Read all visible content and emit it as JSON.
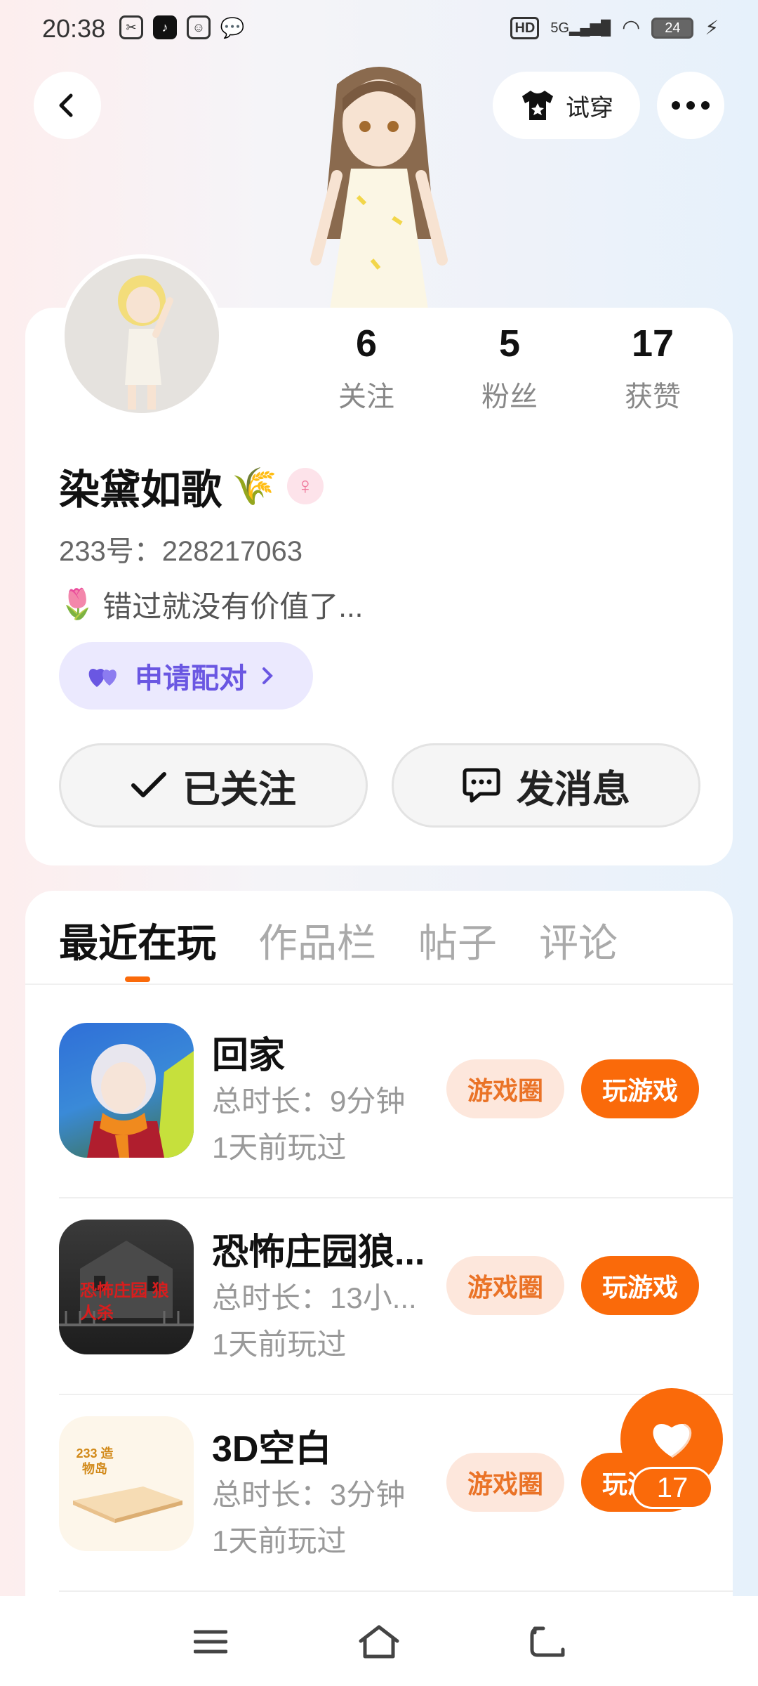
{
  "status_bar": {
    "time": "20:38",
    "battery": "24",
    "network": "5G",
    "hd": "HD"
  },
  "header": {
    "try_on_label": "试穿"
  },
  "profile": {
    "stats": [
      {
        "value": "6",
        "label": "关注"
      },
      {
        "value": "5",
        "label": "粉丝"
      },
      {
        "value": "17",
        "label": "获赞"
      }
    ],
    "name": "染黛如歌",
    "name_emoji": "🌾",
    "gender_symbol": "♀",
    "uid": "233号：228217063",
    "bio_emoji": "🌷",
    "bio": "错过就没有价值了...",
    "match_label": "申请配对",
    "follow_label": "已关注",
    "message_label": "发消息"
  },
  "tabs": [
    {
      "label": "最近在玩",
      "active": true
    },
    {
      "label": "作品栏",
      "active": false
    },
    {
      "label": "帖子",
      "active": false
    },
    {
      "label": "评论",
      "active": false
    }
  ],
  "games": [
    {
      "title": "回家",
      "duration": "总时长：9分钟",
      "last_played": "1天前玩过",
      "circle_label": "游戏圈",
      "play_label": "玩游戏"
    },
    {
      "title": "恐怖庄园狼...",
      "duration": "总时长：13小...",
      "last_played": "1天前玩过",
      "circle_label": "游戏圈",
      "play_label": "玩游戏",
      "icon_text": "恐怖庄园 狼人杀"
    },
    {
      "title": "3D空白",
      "duration": "总时长：3分钟",
      "last_played": "1天前玩过",
      "circle_label": "游戏圈",
      "play_label": "玩游戏",
      "icon_text": "233 造物岛"
    }
  ],
  "like_fab": {
    "count": "17"
  },
  "colors": {
    "accent": "#fa6a0a",
    "match": "#6a57e2"
  }
}
